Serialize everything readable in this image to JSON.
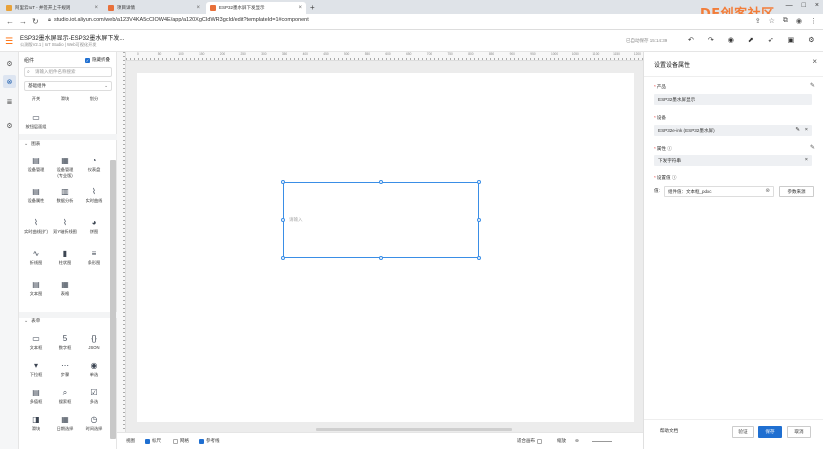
{
  "browser": {
    "tabs": [
      {
        "label": "阿里云IoT - 并签开上千规则",
        "color": "#e8a23a"
      },
      {
        "label": "项目详情",
        "color": "#e8703a"
      },
      {
        "label": "ESP32墨水屏下发显示",
        "color": "#e8703a"
      }
    ],
    "new_tab": "+",
    "url": "studio.iot.aliyun.com/web/a123V4KA5cCIOW4E/app/a120XgCIdWR3gcId/edit?templateId=1#component",
    "logo_text": "DF创客社区",
    "window_controls": [
      "—",
      "□",
      "×"
    ]
  },
  "app": {
    "title": "ESP32墨水屏显示-ESP32墨水屏下发...",
    "subtitle": "公测版V2.1 | IoT Studio | Web可视化开发",
    "saved_time": "已自动保存 15:14:39",
    "toolbar_icons": [
      "undo-icon",
      "redo-icon",
      "preview-icon",
      "publish-icon",
      "rocket-icon",
      "save-icon",
      "settings-icon"
    ]
  },
  "rail": {
    "items": [
      "gear-icon",
      "component-icon",
      "layers-icon",
      "settings-icon"
    ]
  },
  "panel": {
    "title": "组件",
    "hide_toggle_label": "隐藏折叠",
    "search_placeholder": "请输入组件名称搜索",
    "category_select": "基础组件",
    "top_partial": [
      "开关",
      "滑块",
      "划分"
    ],
    "top_item": "按钮层面组",
    "sections": [
      {
        "title": "图表"
      },
      {
        "title": "表单"
      }
    ],
    "chart_components": [
      {
        "label": "设备管理",
        "icon": "▤"
      },
      {
        "label": "设备管理\n(专业版)",
        "icon": "▦"
      },
      {
        "label": "仪表盘",
        "icon": "◔"
      },
      {
        "label": "设备属性",
        "icon": "▤"
      },
      {
        "label": "数据分析",
        "icon": "▥"
      },
      {
        "label": "实时曲线",
        "icon": "⌇"
      },
      {
        "label": "实时曲线(扩)",
        "icon": "⌇"
      },
      {
        "label": "双Y轴折线图",
        "icon": "⌇"
      },
      {
        "label": "饼图",
        "icon": "◕"
      },
      {
        "label": "折线图",
        "icon": "∿"
      },
      {
        "label": "柱状图",
        "icon": "▮"
      },
      {
        "label": "条形图",
        "icon": "≡"
      },
      {
        "label": "文本图",
        "icon": "▤"
      },
      {
        "label": "表格",
        "icon": "▦"
      }
    ],
    "form_components": [
      {
        "label": "文本框",
        "icon": "▭"
      },
      {
        "label": "数字框",
        "icon": "5"
      },
      {
        "label": "JSON",
        "icon": "{}"
      },
      {
        "label": "下拉框",
        "icon": "▾"
      },
      {
        "label": "步骤",
        "icon": "⋯"
      },
      {
        "label": "单选",
        "icon": "◉"
      },
      {
        "label": "多值框",
        "icon": "▤"
      },
      {
        "label": "搜索框",
        "icon": "⌕"
      },
      {
        "label": "多选",
        "icon": "☑"
      },
      {
        "label": "滑块",
        "icon": "◨"
      },
      {
        "label": "日期选择",
        "icon": "▦"
      },
      {
        "label": "时间选择",
        "icon": "◷"
      }
    ]
  },
  "ruler": {
    "top_ticks": [
      "0",
      "50",
      "100",
      "150",
      "200",
      "250",
      "300",
      "350",
      "400",
      "450",
      "500",
      "550",
      "600",
      "650",
      "700",
      "750",
      "800",
      "850",
      "900",
      "950",
      "1000",
      "1050",
      "1100",
      "1150",
      "1200"
    ]
  },
  "canvas": {
    "widget_placeholder": "请输入"
  },
  "statusbar": {
    "items": [
      {
        "label": "视图",
        "checked": false,
        "checkbox": false
      },
      {
        "label": "标尺",
        "checked": true,
        "checkbox": true
      },
      {
        "label": "网格",
        "checked": false,
        "checkbox": true
      },
      {
        "label": "参考线",
        "checked": true,
        "checkbox": true
      }
    ],
    "fit_label": "适合画布",
    "zoom_label": "缩放"
  },
  "props": {
    "title": "设置设备属性",
    "product_label": "产品",
    "product_value": "ESP32墨水屏显示",
    "device_label": "设备",
    "device_value": "ESP32e-ink (ESP32墨水屏)",
    "attr_label": "属性",
    "attr_value": "下发字符串",
    "setvalue_label": "设置值",
    "value_prefix": "值:",
    "value_input": "组件值：文本框_pdxc",
    "param_button": "参数来源",
    "footer": {
      "help": "帮助文档",
      "verify": "验证",
      "save": "保存",
      "cancel": "取消"
    }
  },
  "colors": {
    "accent": "#1f6fd1",
    "brand_orange": "#ff6a00",
    "selection": "#3a8ee6"
  }
}
